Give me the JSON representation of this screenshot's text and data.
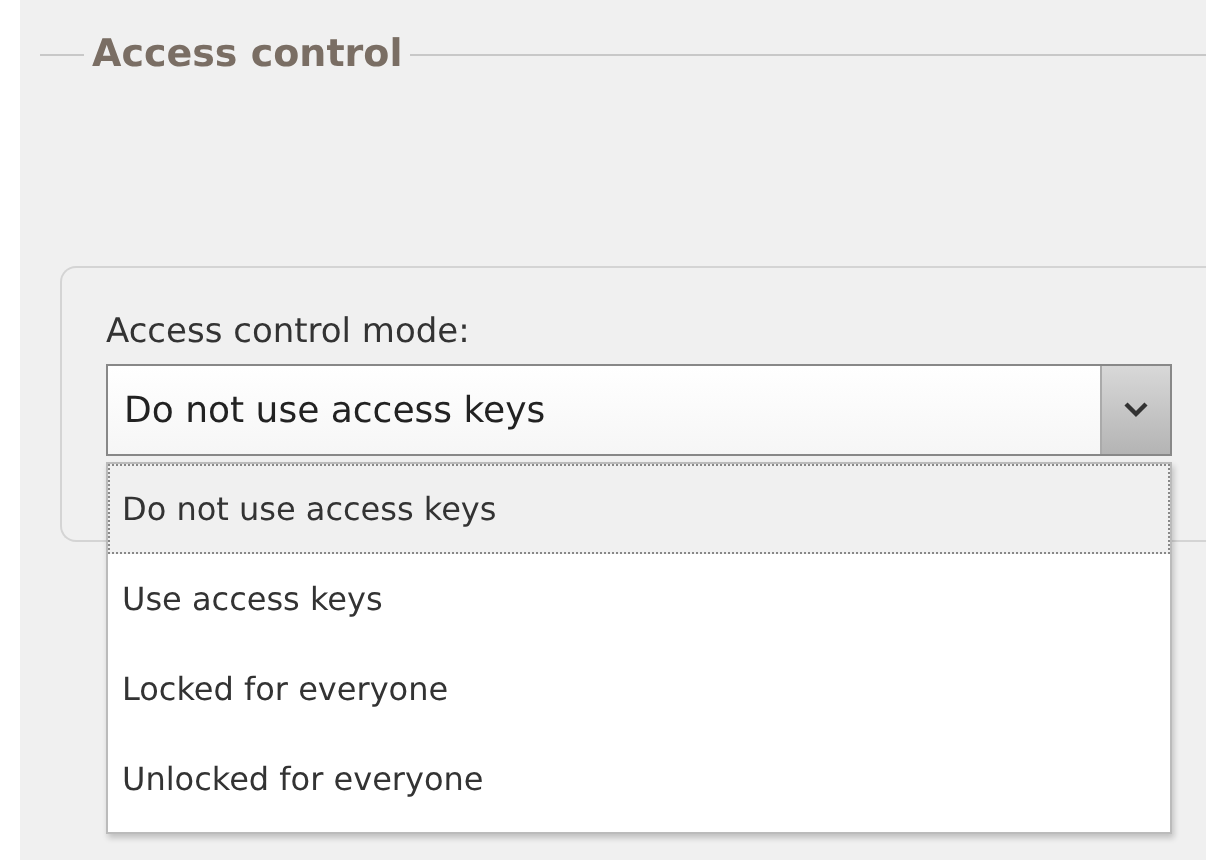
{
  "section": {
    "title": "Access control"
  },
  "mode_field": {
    "label": "Access control mode:",
    "value": "Do not use access keys",
    "expanded": true,
    "options": [
      {
        "label": "Do not use access keys",
        "selected": true
      },
      {
        "label": "Use access keys",
        "selected": false
      },
      {
        "label": "Locked for everyone",
        "selected": false
      },
      {
        "label": "Unlocked for everyone",
        "selected": false
      }
    ]
  }
}
